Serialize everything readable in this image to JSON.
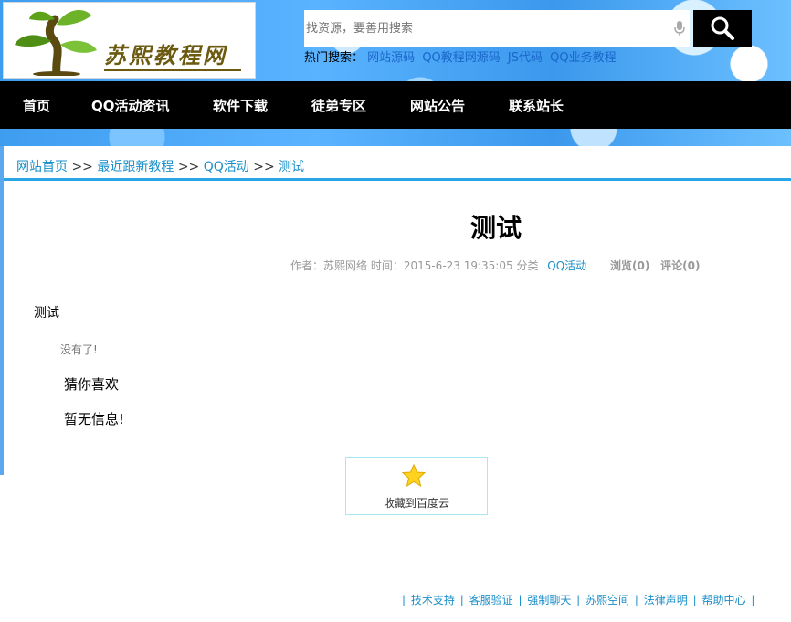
{
  "search": {
    "placeholder": "找资源，要善用搜索",
    "hot_label": "热门搜索：",
    "hot_keywords": [
      "网站源码",
      "QQ教程网源码",
      "JS代码",
      "QQ业务教程"
    ]
  },
  "logo": {
    "text": "苏熙教程网"
  },
  "nav": [
    "首页",
    "QQ活动资讯",
    "软件下载",
    "徒弟专区",
    "网站公告",
    "联系站长"
  ],
  "breadcrumb": {
    "home": "网站首页",
    "sep": ">>",
    "level1": "最近跟新教程",
    "level2": "QQ活动",
    "current": "测试"
  },
  "article": {
    "title": "测试",
    "meta_prefix": "作者：苏熙网络 时间：2015-6-23 19:35:05  分类",
    "category": "QQ活动",
    "views": "浏览(0)",
    "comments": "评论(0)",
    "body": "测试",
    "no_more": "没有了!",
    "guess_title": "猜你喜欢",
    "no_info": "暂无信息!"
  },
  "favorite": {
    "label": "收藏到百度云"
  },
  "footer": [
    "技术支持",
    "客服验证",
    "强制聊天",
    "苏熙空间",
    "法律声明",
    "帮助中心"
  ],
  "colors": {
    "nav_bg": "#000000",
    "link": "#1a8fc9",
    "accent_line": "#2aa5e6"
  }
}
